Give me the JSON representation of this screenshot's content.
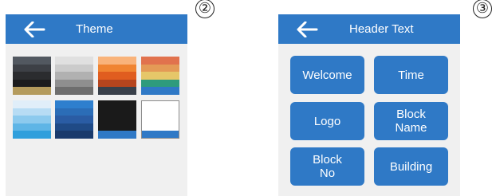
{
  "step_markers": {
    "theme": "②",
    "header_text": "③"
  },
  "theme_panel": {
    "title": "Theme",
    "back_icon": "arrow-left-icon",
    "colors": {
      "header_bar": "#2f79c6",
      "panel_bg": "#f0f0f0"
    },
    "swatches": [
      {
        "name": "dark-gold",
        "stripes": [
          "#525860",
          "#3d4046",
          "#2b2c2f",
          "#1c1c1d",
          "#b59b5c"
        ]
      },
      {
        "name": "silver-gray",
        "stripes": [
          "#e0e0e0",
          "#cbcbcb",
          "#b1b1b1",
          "#8f8f8f",
          "#6e6e6e"
        ]
      },
      {
        "name": "orange-sunset",
        "stripes": [
          "#f9b37a",
          "#f08431",
          "#e05d1f",
          "#b6451e",
          "#39404a"
        ]
      },
      {
        "name": "multicolor",
        "stripes": [
          "#e1724d",
          "#e49a56",
          "#e6c769",
          "#2e9b7c",
          "#2f79c6"
        ]
      },
      {
        "name": "light-sky",
        "stripes": [
          "#e0eef9",
          "#b7dcf4",
          "#8ccaee",
          "#5eb5e6",
          "#2f9fdc"
        ]
      },
      {
        "name": "blue",
        "stripes": [
          "#2e7fce",
          "#2b6db7",
          "#2a5ca4",
          "#1f4a86",
          "#1a3a6c"
        ]
      },
      {
        "name": "black",
        "stripes": [
          "#1a1a1a",
          "#1a1a1a",
          "#1a1a1a",
          "#1a1a1a",
          "#2f79c6"
        ]
      },
      {
        "name": "white",
        "stripes": [
          "#ffffff",
          "#ffffff",
          "#ffffff",
          "#ffffff",
          "#2f79c6"
        ]
      }
    ]
  },
  "header_text_panel": {
    "title": "Header Text",
    "back_icon": "arrow-left-icon",
    "options": [
      {
        "key": "welcome",
        "label": "Welcome"
      },
      {
        "key": "time",
        "label": "Time"
      },
      {
        "key": "logo",
        "label": "Logo"
      },
      {
        "key": "block-name",
        "label": "Block\nName"
      },
      {
        "key": "block-no",
        "label": "Block\nNo"
      },
      {
        "key": "building",
        "label": "Building"
      }
    ]
  }
}
